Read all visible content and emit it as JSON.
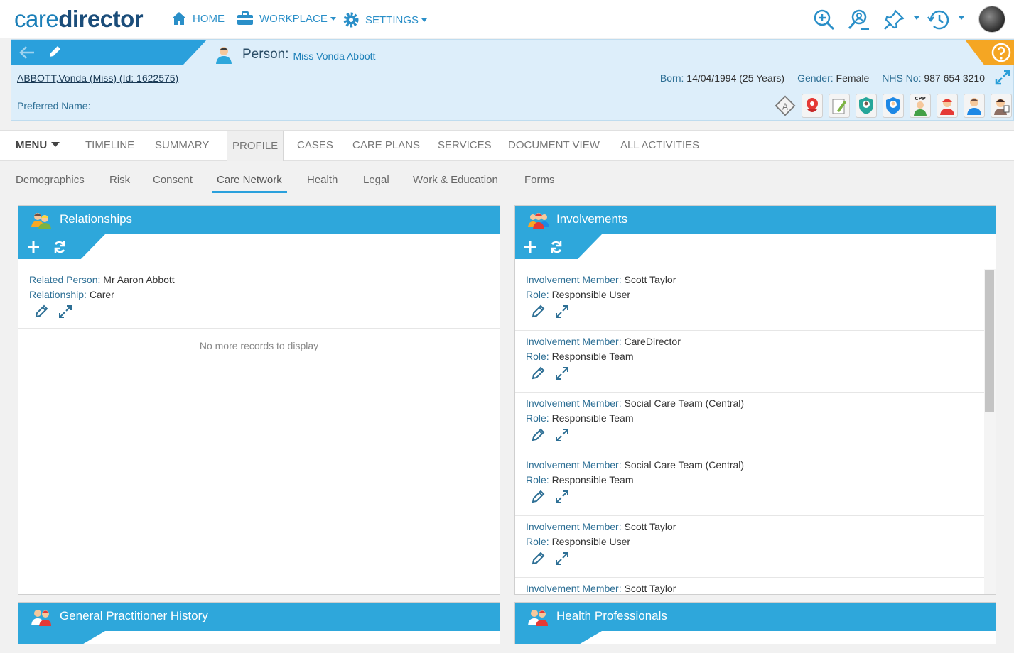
{
  "app": {
    "logo_light": "care",
    "logo_bold": "director"
  },
  "topnav": {
    "home": "HOME",
    "workplace": "WORKPLACE",
    "settings": "SETTINGS",
    "icons": [
      "zoom-in-icon",
      "advanced-search-icon",
      "pin-icon",
      "recent-history-icon"
    ]
  },
  "person": {
    "title_label": "Person:",
    "title_name": "Miss Vonda Abbott",
    "id_line": "ABBOTT,Vonda (Miss) (Id: 1622575)",
    "born_label": "Born:",
    "born_value": "14/04/1994 (25 Years)",
    "gender_label": "Gender:",
    "gender_value": "Female",
    "nhs_label": "NHS No:",
    "nhs_value": "987 654 3210",
    "preferred_label": "Preferred Name:",
    "alert_icons": [
      "allergy-alert-icon",
      "alert-pin-icon",
      "notes-icon",
      "safeguarding-shield-icon",
      "protection-shield-icon",
      "cpp-icon",
      "person-alert-icon",
      "carer-icon",
      "professional-icon"
    ],
    "cpp_text": "CPP"
  },
  "tabs": {
    "menu": "MENU",
    "items": [
      "TIMELINE",
      "SUMMARY",
      "PROFILE",
      "CASES",
      "CARE PLANS",
      "SERVICES",
      "DOCUMENT VIEW",
      "ALL ACTIVITIES"
    ],
    "active": "PROFILE"
  },
  "subtabs": {
    "items": [
      "Demographics",
      "Risk",
      "Consent",
      "Care Network",
      "Health",
      "Legal",
      "Work & Education",
      "Forms"
    ],
    "active": "Care Network"
  },
  "relationships": {
    "title": "Relationships",
    "records": [
      {
        "k1": "Related Person:",
        "v1": "Mr Aaron Abbott",
        "k2": "Relationship:",
        "v2": "Carer"
      }
    ],
    "no_more": "No more records to display"
  },
  "involvements": {
    "title": "Involvements",
    "records": [
      {
        "k1": "Involvement Member:",
        "v1": "Scott Taylor",
        "k2": "Role:",
        "v2": "Responsible User"
      },
      {
        "k1": "Involvement Member:",
        "v1": "CareDirector",
        "k2": "Role:",
        "v2": "Responsible Team"
      },
      {
        "k1": "Involvement Member:",
        "v1": "Social Care Team (Central)",
        "k2": "Role:",
        "v2": "Responsible Team"
      },
      {
        "k1": "Involvement Member:",
        "v1": "Social Care Team (Central)",
        "k2": "Role:",
        "v2": "Responsible Team"
      },
      {
        "k1": "Involvement Member:",
        "v1": "Scott Taylor",
        "k2": "Role:",
        "v2": "Responsible User"
      },
      {
        "k1": "Involvement Member:",
        "v1": "Scott Taylor",
        "k2": "",
        "v2": ""
      }
    ]
  },
  "gp_history": {
    "title": "General Practitioner History"
  },
  "health_professionals": {
    "title": "Health Professionals"
  },
  "colors": {
    "brand_blue": "#2ea7db",
    "help_orange": "#f5a623",
    "header_bg": "#ddeefa",
    "label_teal": "#2d6f95"
  }
}
